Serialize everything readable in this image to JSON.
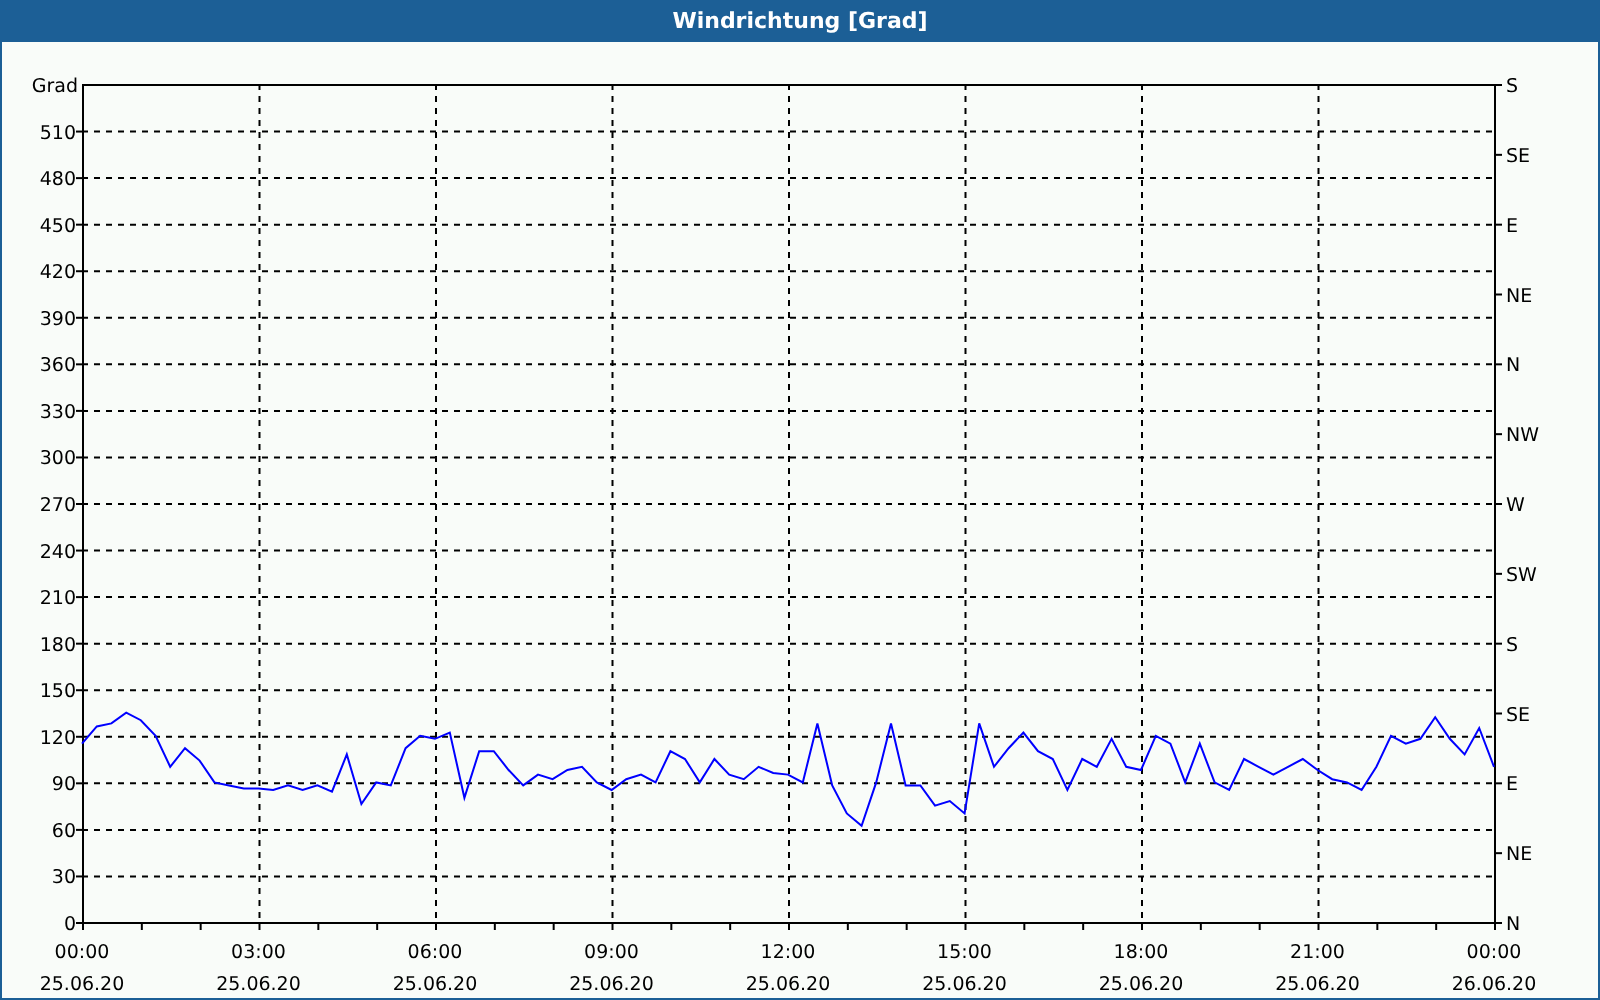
{
  "window": {
    "title": "Windrichtung [Grad]"
  },
  "chart_data": {
    "type": "line",
    "grid": true,
    "ylabel": "Grad",
    "ylim": [
      0,
      540
    ],
    "yticks": [
      0,
      30,
      60,
      90,
      120,
      150,
      180,
      210,
      240,
      270,
      300,
      330,
      360,
      390,
      420,
      450,
      480,
      510
    ],
    "categories": [
      "00:00 25.06.20",
      null,
      null,
      null,
      null,
      null,
      null,
      null,
      null,
      null,
      null,
      null,
      "03:00 25.06.20",
      null,
      null,
      null,
      null,
      null,
      null,
      null,
      null,
      null,
      null,
      null,
      "06:00 25.06.20",
      null,
      null,
      null,
      null,
      null,
      null,
      null,
      null,
      null,
      null,
      null,
      "09:00 25.06.20",
      null,
      null,
      null,
      null,
      null,
      null,
      null,
      null,
      null,
      null,
      null,
      "12:00 25.06.20",
      null,
      null,
      null,
      null,
      null,
      null,
      null,
      null,
      null,
      null,
      null,
      "15:00 25.06.20",
      null,
      null,
      null,
      null,
      null,
      null,
      null,
      null,
      null,
      null,
      null,
      "18:00 25.06.20",
      null,
      null,
      null,
      null,
      null,
      null,
      null,
      null,
      null,
      null,
      null,
      "21:00 25.06.20",
      null,
      null,
      null,
      null,
      null,
      null,
      null,
      null,
      null,
      null,
      null,
      "00:00 26.06.20"
    ],
    "series": [
      {
        "color": "#0000ff",
        "values": [
          115,
          126,
          128,
          135,
          130,
          120,
          100,
          112,
          104,
          90,
          88,
          86,
          86,
          85,
          88,
          85,
          88,
          84,
          108,
          76,
          90,
          88,
          112,
          120,
          118,
          122,
          80,
          110,
          110,
          98,
          88,
          95,
          92,
          98,
          100,
          90,
          85,
          92,
          95,
          90,
          110,
          105,
          90,
          105,
          95,
          92,
          100,
          96,
          95,
          90,
          128,
          88,
          70,
          62,
          90,
          128,
          88,
          88,
          75,
          78,
          70,
          128,
          100,
          112,
          122,
          110,
          105,
          85,
          105,
          100,
          118,
          100,
          98,
          120,
          115,
          90,
          115,
          90,
          85,
          105,
          100,
          95,
          100,
          105,
          98,
          92,
          90,
          85,
          100,
          120,
          115,
          118,
          132,
          118,
          108,
          125,
          100
        ]
      }
    ]
  },
  "direction_axis": {
    "labels": [
      "S",
      "SE",
      "E",
      "NE",
      "N",
      "NW",
      "W",
      "SW",
      "S",
      "SE",
      "E",
      "NE",
      "N"
    ]
  }
}
